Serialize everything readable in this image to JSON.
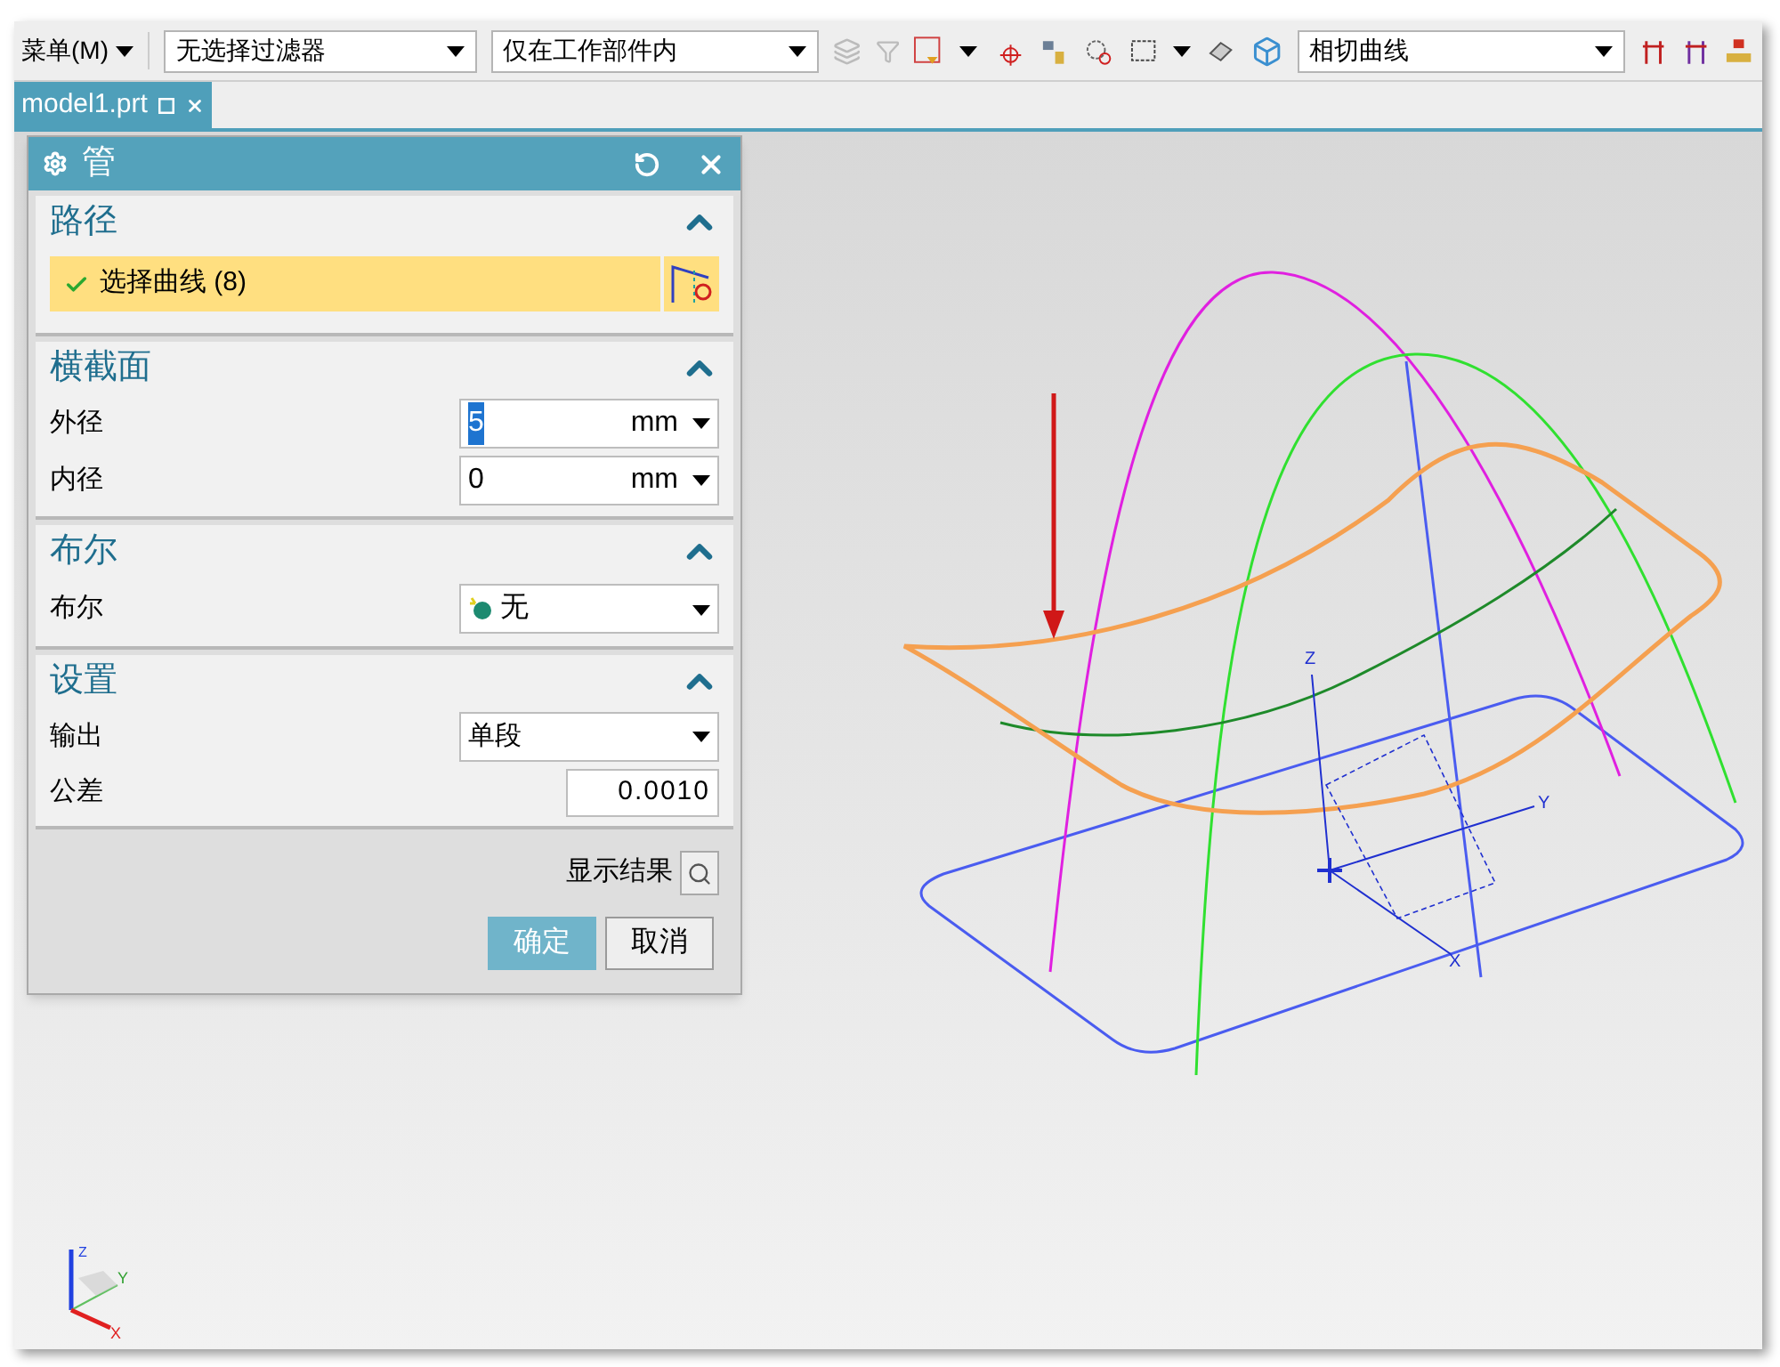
{
  "toolbar": {
    "menu": "菜单(M)",
    "filter_dropdown": "无选择过滤器",
    "scope_dropdown": "仅在工作部件内",
    "curve_rule_dropdown": "相切曲线"
  },
  "tabs": [
    {
      "label": "model1.prt",
      "selected": true
    }
  ],
  "dialog": {
    "title": "管",
    "sections": [
      {
        "title": "路径",
        "expanded": true,
        "rows": [
          {
            "kind": "selection",
            "label": "选择曲线 (8)",
            "complete": true
          }
        ]
      },
      {
        "title": "横截面",
        "expanded": true,
        "rows": [
          {
            "kind": "unit",
            "label": "外径",
            "value": "5",
            "unit": "mm",
            "highlighted": true
          },
          {
            "kind": "unit",
            "label": "内径",
            "value": "0",
            "unit": "mm",
            "highlighted": false
          }
        ]
      },
      {
        "title": "布尔",
        "expanded": true,
        "rows": [
          {
            "kind": "boolean",
            "label": "布尔",
            "value": "无"
          }
        ]
      },
      {
        "title": "设置",
        "expanded": true,
        "rows": [
          {
            "kind": "dropdown",
            "label": "输出",
            "value": "单段"
          },
          {
            "kind": "number",
            "label": "公差",
            "value": "0.0010"
          }
        ]
      }
    ],
    "preview_label": "显示结果",
    "buttons": [
      {
        "label": "确定",
        "primary": true
      },
      {
        "label": "取消",
        "primary": false
      }
    ]
  },
  "viewport": {
    "axis_labels": [
      "Z",
      "Y",
      "X"
    ],
    "triad_labels": [
      "Z",
      "Y",
      "X"
    ]
  }
}
